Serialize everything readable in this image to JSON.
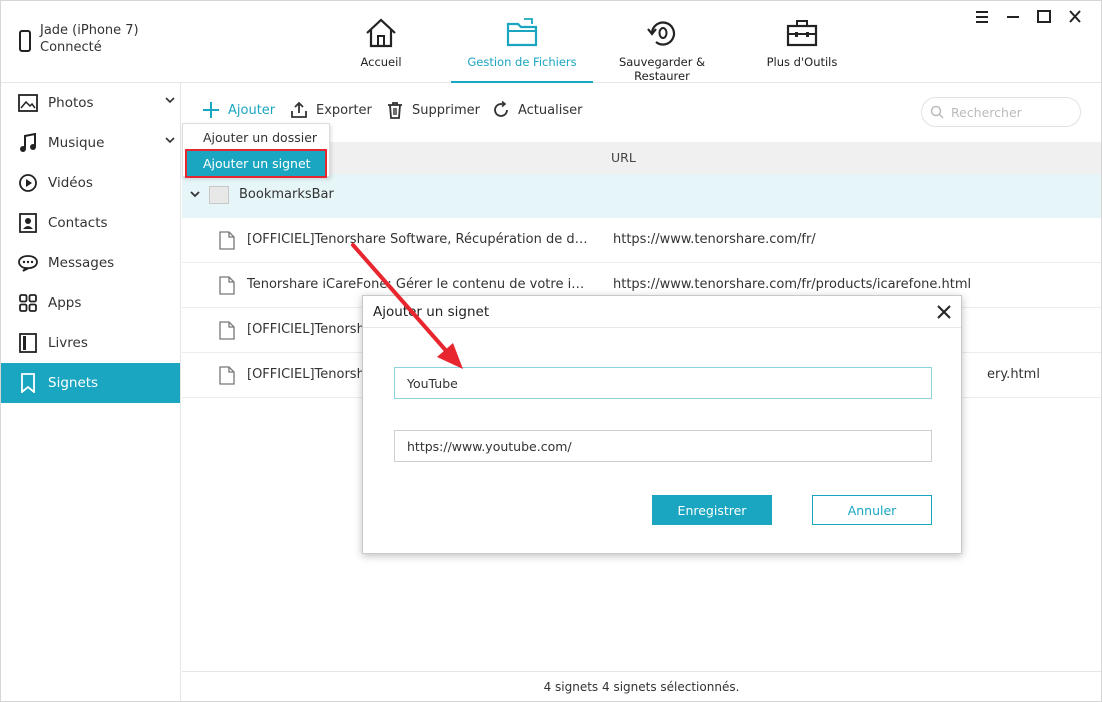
{
  "device": {
    "name": "Jade (iPhone 7)",
    "status": "Connecté"
  },
  "nav": [
    {
      "label": "Accueil",
      "icon": "home-icon"
    },
    {
      "label": "Gestion de Fichiers",
      "icon": "folder-icon",
      "active": true
    },
    {
      "label": "Sauvegarder & Restaurer",
      "icon": "backup-restore-icon"
    },
    {
      "label": "Plus d'Outils",
      "icon": "toolbox-icon"
    }
  ],
  "sidebar": {
    "items": [
      {
        "label": "Photos",
        "icon": "photo-icon"
      },
      {
        "label": "Musique",
        "icon": "music-icon"
      },
      {
        "label": "Vidéos",
        "icon": "video-icon"
      },
      {
        "label": "Contacts",
        "icon": "contact-icon"
      },
      {
        "label": "Messages",
        "icon": "message-icon"
      },
      {
        "label": "Apps",
        "icon": "apps-icon"
      },
      {
        "label": "Livres",
        "icon": "book-icon"
      },
      {
        "label": "Signets",
        "icon": "bookmark-icon",
        "active": true
      }
    ]
  },
  "toolbar": {
    "add_label": "Ajouter",
    "export_label": "Exporter",
    "delete_label": "Supprimer",
    "refresh_label": "Actualiser",
    "search_placeholder": "Rechercher"
  },
  "dropdown": {
    "add_folder": "Ajouter un dossier",
    "add_bookmark": "Ajouter un signet"
  },
  "table": {
    "url_header": "URL",
    "folder": "BookmarksBar",
    "rows": [
      {
        "name": "[OFFICIEL]Tenorshare Software, Récupération de données...",
        "url": "https://www.tenorshare.com/fr/"
      },
      {
        "name": "Tenorshare iCareFone: Gérer le contenu de votre iPhone/i...",
        "url": "https://www.tenorshare.com/fr/products/icarefone.html"
      },
      {
        "name": "[OFFICIEL]Tenorshare",
        "url": ""
      },
      {
        "name": "[OFFICIEL]Tenorshare",
        "url": "ery.html"
      }
    ]
  },
  "status": "4 signets 4 signets sélectionnés.",
  "dialog": {
    "title": "Ajouter un signet",
    "name_value": "YouTube",
    "url_value": "https://www.youtube.com/",
    "save_label": "Enregistrer",
    "cancel_label": "Annuler"
  },
  "colors": {
    "accent": "#1aa6c0",
    "highlight_box": "#e8262f",
    "arrow": "#e8262f"
  }
}
